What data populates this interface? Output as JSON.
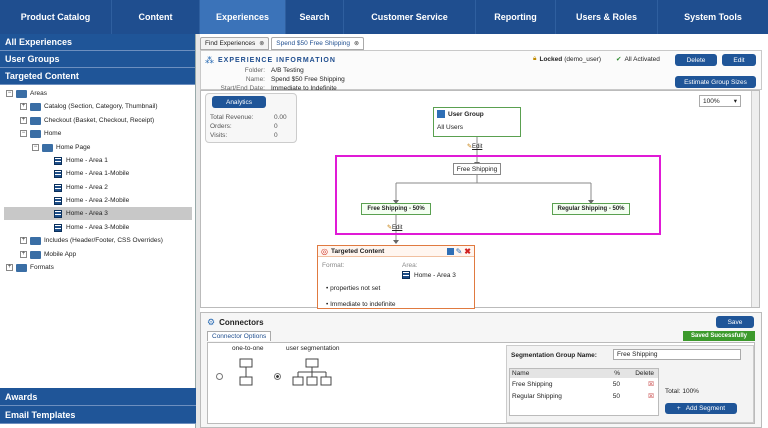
{
  "topnav": {
    "tabs": [
      "Product Catalog",
      "Content",
      "Experiences",
      "Search",
      "Customer Service",
      "Reporting",
      "Users & Roles",
      "System Tools"
    ]
  },
  "left": {
    "accordions": [
      "All Experiences",
      "User Groups",
      "Targeted Content"
    ],
    "tree": {
      "areas": "Areas",
      "catalog": "Catalog (Section, Category, Thumbnail)",
      "checkout": "Checkout (Basket, Checkout, Receipt)",
      "home": "Home",
      "home_page": "Home Page",
      "pages": [
        "Home - Area 1",
        "Home - Area 1-Mobile",
        "Home - Area 2",
        "Home - Area 2-Mobile",
        "Home - Area 3",
        "Home - Area 3-Mobile"
      ],
      "includes": "Includes (Header/Footer, CSS Overrides)",
      "mobile": "Mobile App",
      "formats": "Formats"
    },
    "bottom_accordions": [
      "Awards",
      "Email Templates"
    ]
  },
  "tabs": [
    {
      "label": "Find Experiences"
    },
    {
      "label": "Spend $50 Free Shipping"
    }
  ],
  "header": {
    "title": "EXPERIENCE INFORMATION",
    "folder_label": "Folder:",
    "folder": "A/B Testing",
    "name_label": "Name:",
    "name": "Spend $50 Free Shipping",
    "dates_label": "Start/End Date:",
    "dates": "Immediate to Indefinite",
    "locked": "Locked",
    "locked_user": "(demo_user)",
    "activated": "All Activated",
    "delete": "Delete",
    "edit": "Edit",
    "estimate": "Estimate Group Sizes"
  },
  "stats": {
    "analytics": "Analytics",
    "revenue_label": "Total Revenue:",
    "revenue": "0.00",
    "orders_label": "Orders:",
    "orders": "0",
    "visits_label": "Visits:",
    "visits": "0"
  },
  "zoom": "100%",
  "flow": {
    "user_group_title": "User Group",
    "user_group": "All Users",
    "edit": "Edit",
    "split": "Free Shipping",
    "branch_a": "Free Shipping - 50%",
    "branch_b": "Regular Shipping - 50%",
    "tc_title": "Targeted Content",
    "format_label": "Format:",
    "area_label": "Area:",
    "area": "Home - Area 3",
    "props": "properties not set",
    "immediate": "Immediate to indefinite"
  },
  "connectors": {
    "title": "Connectors",
    "save": "Save",
    "saved": "Saved Successfully",
    "options_tab": "Connector Options",
    "one_to_one": "one-to-one",
    "user_seg": "user segmentation",
    "seg_group_label": "Segmentation Group Name:",
    "seg_group": "Free Shipping",
    "cols": [
      "Name",
      "%",
      "Delete"
    ],
    "rows": [
      {
        "name": "Free Shipping",
        "pct": "50"
      },
      {
        "name": "Regular Shipping",
        "pct": "50"
      }
    ],
    "total": "Total: 100%",
    "add": "Add Segment"
  }
}
